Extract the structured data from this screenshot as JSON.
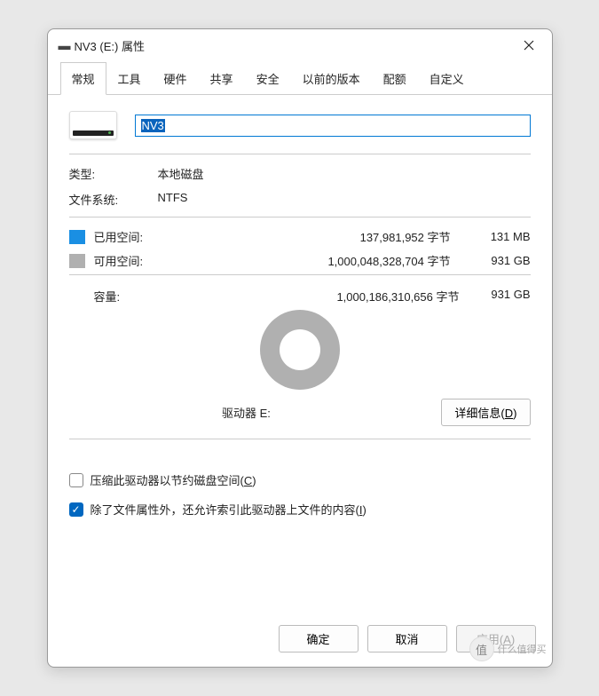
{
  "title": "NV3 (E:) 属性",
  "tabs": [
    "常规",
    "工具",
    "硬件",
    "共享",
    "安全",
    "以前的版本",
    "配额",
    "自定义"
  ],
  "active_tab": 0,
  "drive_name": "NV3",
  "type_label": "类型:",
  "type_value": "本地磁盘",
  "fs_label": "文件系统:",
  "fs_value": "NTFS",
  "used_label": "已用空间:",
  "used_bytes": "137,981,952 字节",
  "used_hr": "131 MB",
  "free_label": "可用空间:",
  "free_bytes": "1,000,048,328,704 字节",
  "free_hr": "931 GB",
  "cap_label": "容量:",
  "cap_bytes": "1,000,186,310,656 字节",
  "cap_hr": "931 GB",
  "drive_line": "驱动器 E:",
  "details_btn": "详细信息(D)",
  "compress_label": "压缩此驱动器以节约磁盘空间(C)",
  "index_label": "除了文件属性外，还允许索引此驱动器上文件的内容(I)",
  "compress_checked": false,
  "index_checked": true,
  "ok": "确定",
  "cancel": "取消",
  "apply": "应用(A)",
  "watermark": "什么值得买",
  "watermark_badge": "值",
  "colors": {
    "used": "#1a8fe3",
    "free": "#b0b0b0",
    "accent": "#0067c0"
  },
  "chart_data": {
    "type": "pie",
    "title": "驱动器 E:",
    "series": [
      {
        "name": "已用空间",
        "value": 137981952,
        "label": "131 MB",
        "color": "#1a8fe3"
      },
      {
        "name": "可用空间",
        "value": 1000048328704,
        "label": "931 GB",
        "color": "#b0b0b0"
      }
    ],
    "total": {
      "name": "容量",
      "value": 1000186310656,
      "label": "931 GB"
    }
  }
}
